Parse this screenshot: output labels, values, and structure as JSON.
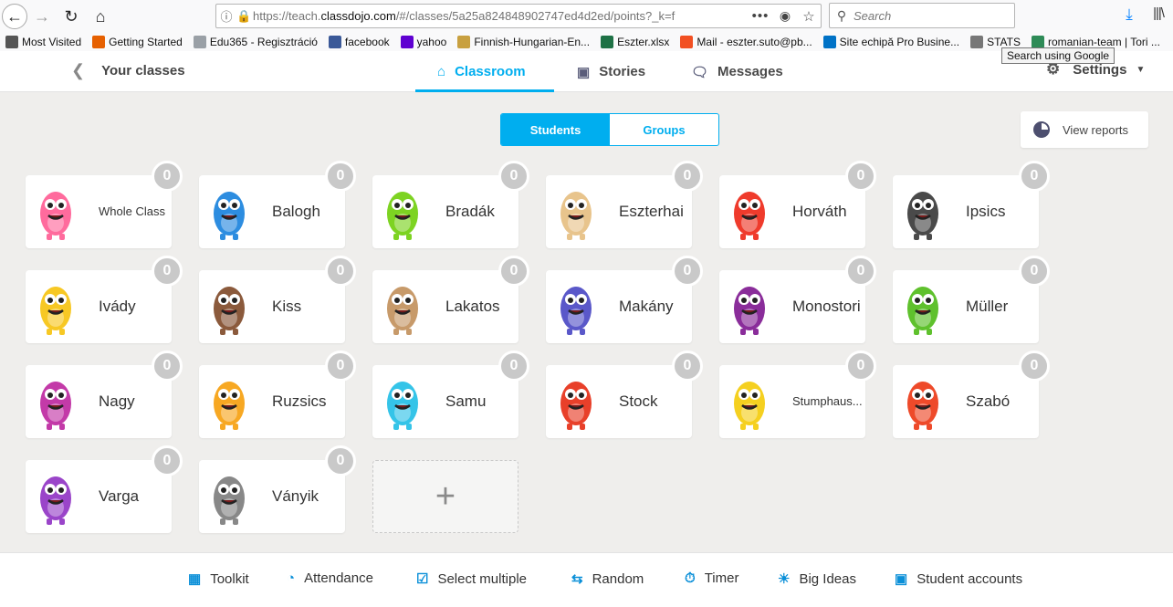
{
  "browser": {
    "url_prefix": "https://teach.",
    "url_domain": "classdojo.com",
    "url_rest": "/#/classes/5a25a824848902747ed4d2ed/points?_k=f",
    "search_placeholder": "Search",
    "tooltip": "Search using Google",
    "bookmarks": [
      {
        "label": "Most Visited",
        "icon": "gear-icon",
        "color": "#555555"
      },
      {
        "label": "Getting Started",
        "icon": "firefox-icon",
        "color": "#e66000"
      },
      {
        "label": "Edu365 - Regisztráció",
        "icon": "page-icon",
        "color": "#9aa0a6"
      },
      {
        "label": "facebook",
        "icon": "facebook-icon",
        "color": "#3b5998"
      },
      {
        "label": "yahoo",
        "icon": "yahoo-icon",
        "color": "#5f01d1"
      },
      {
        "label": "Finnish-Hungarian-En...",
        "icon": "book-icon",
        "color": "#c8a040"
      },
      {
        "label": "Eszter.xlsx",
        "icon": "excel-icon",
        "color": "#1e7145"
      },
      {
        "label": "Mail - eszter.suto@pb...",
        "icon": "microsoft-icon",
        "color": "#f25022"
      },
      {
        "label": "Site echipă Pro Busine...",
        "icon": "sharepoint-icon",
        "color": "#0072c6"
      },
      {
        "label": "STATS",
        "icon": "globe-icon",
        "color": "#777777"
      },
      {
        "label": "romanian-team | Tori ...",
        "icon": "sheet-icon",
        "color": "#2e8b57"
      }
    ]
  },
  "header": {
    "back_label": "Your classes",
    "tabs": [
      {
        "label": "Classroom",
        "icon": "home-icon"
      },
      {
        "label": "Stories",
        "icon": "image-icon"
      },
      {
        "label": "Messages",
        "icon": "chat-icon"
      }
    ],
    "settings_label": "Settings"
  },
  "toggle": {
    "students": "Students",
    "groups": "Groups"
  },
  "reports_label": "View reports",
  "students": [
    {
      "name": "Whole Class",
      "points": "0",
      "color": "#ff6b9d"
    },
    {
      "name": "Balogh",
      "points": "0",
      "color": "#2d8de0"
    },
    {
      "name": "Bradák",
      "points": "0",
      "color": "#7dd322"
    },
    {
      "name": "Eszterhai",
      "points": "0",
      "color": "#e8c48c"
    },
    {
      "name": "Horváth",
      "points": "0",
      "color": "#ef3b2c"
    },
    {
      "name": "Ipsics",
      "points": "0",
      "color": "#4a4a4a"
    },
    {
      "name": "Ivády",
      "points": "0",
      "color": "#f7c824"
    },
    {
      "name": "Kiss",
      "points": "0",
      "color": "#8b5a3c"
    },
    {
      "name": "Lakatos",
      "points": "0",
      "color": "#c79a6a"
    },
    {
      "name": "Makány",
      "points": "0",
      "color": "#5a58c9"
    },
    {
      "name": "Monostori",
      "points": "0",
      "color": "#8a2d9a"
    },
    {
      "name": "Müller",
      "points": "0",
      "color": "#5fc12d"
    },
    {
      "name": "Nagy",
      "points": "0",
      "color": "#c33aa8"
    },
    {
      "name": "Ruzsics",
      "points": "0",
      "color": "#f7a823"
    },
    {
      "name": "Samu",
      "points": "0",
      "color": "#35c4e8"
    },
    {
      "name": "Stock",
      "points": "0",
      "color": "#e8402a"
    },
    {
      "name": "Stumphaus...",
      "points": "0",
      "color": "#f5d020"
    },
    {
      "name": "Szabó",
      "points": "0",
      "color": "#ee4a2a"
    },
    {
      "name": "Varga",
      "points": "0",
      "color": "#9a45c9"
    },
    {
      "name": "Ványik",
      "points": "0",
      "color": "#888888"
    }
  ],
  "toolbar": [
    {
      "label": "Toolkit",
      "icon": "grid-icon"
    },
    {
      "label": "Attendance",
      "icon": "clock-icon"
    },
    {
      "label": "Select multiple",
      "icon": "checkbox-icon"
    },
    {
      "label": "Random",
      "icon": "shuffle-icon"
    },
    {
      "label": "Timer",
      "icon": "stopwatch-icon"
    },
    {
      "label": "Big Ideas",
      "icon": "lightbulb-icon"
    },
    {
      "label": "Student accounts",
      "icon": "student-accounts-icon"
    }
  ],
  "accent": "#00aeef"
}
